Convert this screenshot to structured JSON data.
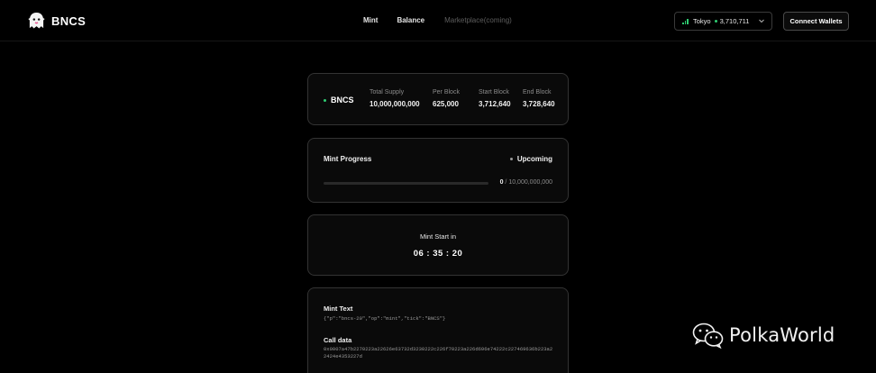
{
  "header": {
    "brand": "BNCS",
    "nav": {
      "mint": "Mint",
      "balance": "Balance",
      "marketplace": "Marketplace(coming)"
    },
    "network": {
      "name": "Tokyo",
      "block_height": "3,710,711",
      "status_color": "#2ecc71"
    },
    "connect_label": "Connect Wallets"
  },
  "token_card": {
    "ticker": "BNCS",
    "stats": [
      {
        "label": "Total Supply",
        "value": "10,000,000,000"
      },
      {
        "label": "Per Block",
        "value": "625,000"
      },
      {
        "label": "Start Block",
        "value": "3,712,640"
      },
      {
        "label": "End Block",
        "value": "3,728,640"
      }
    ]
  },
  "progress_card": {
    "title": "Mint Progress",
    "status": "Upcoming",
    "progress_percent": 0,
    "minted": "0",
    "separator": "/",
    "total": "10,000,000,000"
  },
  "countdown_card": {
    "label": "Mint Start in",
    "time": "06 : 35 : 20"
  },
  "mint_text_card": {
    "mint_text_label": "Mint Text",
    "mint_text_value": "{\"p\":\"bncs-20\",\"op\":\"mint\",\"tick\":\"BNCS\"}",
    "call_data_label": "Call data",
    "call_data_value": "0x0007a47b2270223a22626e63732d3230222c226f70223a226d696e74222c227469636b223a22424e4353227d"
  },
  "watermark": {
    "text": "PolkaWorld"
  },
  "colors": {
    "background": "#000000",
    "card_border": "#333333",
    "accent_green": "#2ecc71",
    "muted_text": "#8c8c8c"
  }
}
